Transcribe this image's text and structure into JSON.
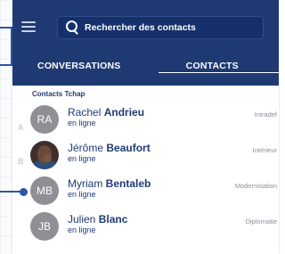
{
  "header": {
    "search": {
      "placeholder": "Rechercher des contacts"
    },
    "tabs": [
      {
        "label": "CONVERSATIONS",
        "active": false
      },
      {
        "label": "CONTACTS",
        "active": true
      }
    ]
  },
  "contacts": {
    "section_title": "Contacts Tchap",
    "index_letters": [
      "A",
      "B"
    ],
    "items": [
      {
        "initials": "RA",
        "first": "Rachel",
        "last": "Andrieu",
        "status": "en ligne",
        "dept": "Intradef",
        "avatar": "initials"
      },
      {
        "initials": "",
        "first": "Jérôme",
        "last": "Beaufort",
        "status": "en ligne",
        "dept": "Intérieur",
        "avatar": "photo"
      },
      {
        "initials": "MB",
        "first": "Myriam",
        "last": "Bentaleb",
        "status": "en ligne",
        "dept": "Modernisation",
        "avatar": "initials"
      },
      {
        "initials": "JB",
        "first": "Julien",
        "last": "Blanc",
        "status": "en ligne",
        "dept": "Diplomatie",
        "avatar": "initials"
      }
    ]
  },
  "colors": {
    "header_bg": "#1f3a73",
    "accent": "#2a55a8",
    "avatar_bg": "#8f9096"
  }
}
